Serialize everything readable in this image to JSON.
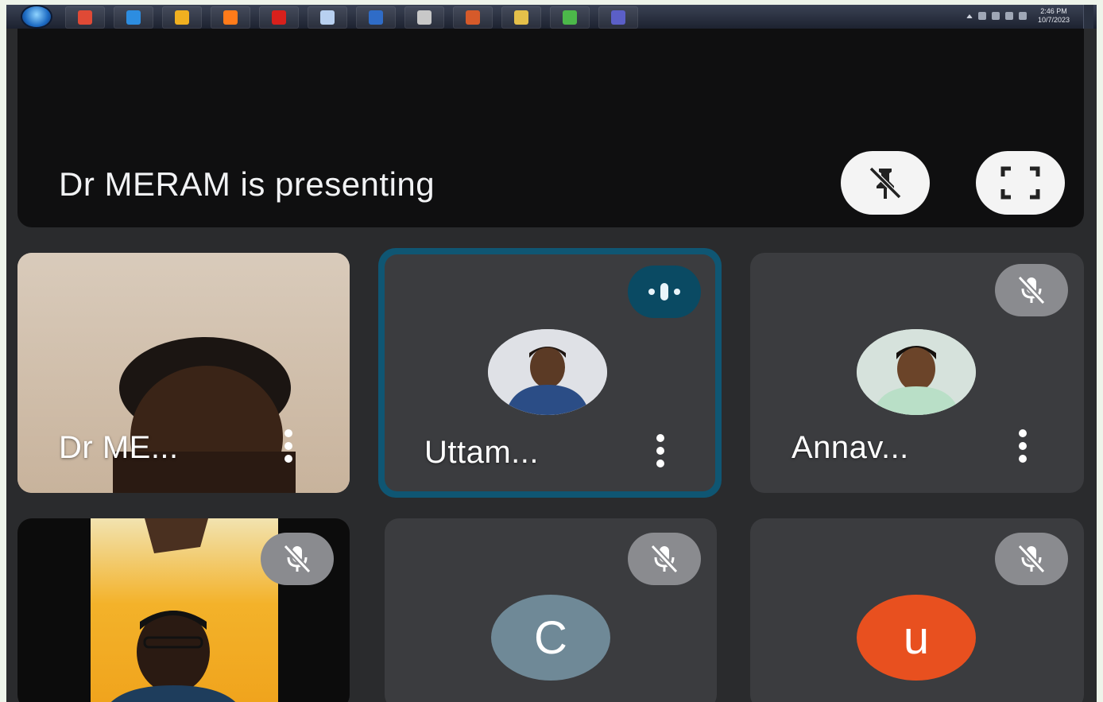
{
  "taskbar": {
    "apps": [
      {
        "icon": "chrome-icon",
        "color": "#e04a36"
      },
      {
        "icon": "internet-explorer-icon",
        "color": "#2d8de0"
      },
      {
        "icon": "media-player-icon",
        "color": "#f0b020"
      },
      {
        "icon": "firefox-icon",
        "color": "#ff7b1a"
      },
      {
        "icon": "acrobat-reader-icon",
        "color": "#d8201c"
      },
      {
        "icon": "notepad-icon",
        "color": "#b8d0f0"
      },
      {
        "icon": "word-icon",
        "color": "#2f6cc7"
      },
      {
        "icon": "search-tool-icon",
        "color": "#c8c8c8"
      },
      {
        "icon": "powerpoint-icon",
        "color": "#d65a2a"
      },
      {
        "icon": "file-explorer-icon",
        "color": "#e5c04a"
      },
      {
        "icon": "utorrent-icon",
        "color": "#4cb84a"
      },
      {
        "icon": "teams-icon",
        "color": "#5b5fc7"
      }
    ],
    "clock_time": "2:46 PM",
    "clock_date": "10/7/2023"
  },
  "presentation": {
    "banner_text": "Dr MERAM is presenting",
    "unpin_icon": "unpin-icon",
    "fullscreen_icon": "fullscreen-icon"
  },
  "participants": [
    {
      "name": "Dr ME...",
      "type": "video"
    },
    {
      "name": "Uttam...",
      "type": "avatar-photo",
      "speaking": true
    },
    {
      "name": "Annav...",
      "type": "avatar-photo",
      "muted": true
    },
    {
      "name": "",
      "type": "video",
      "muted": true
    },
    {
      "name": "",
      "type": "letter",
      "letter": "C",
      "muted": true,
      "color": "#6f8997"
    },
    {
      "name": "",
      "type": "letter",
      "letter": "u",
      "muted": true,
      "color": "#e8501f"
    }
  ],
  "colors": {
    "speaking_border": "#0d5c79",
    "speaking_indicator": "#0a4a63",
    "tile_bg": "#3b3c3f"
  }
}
